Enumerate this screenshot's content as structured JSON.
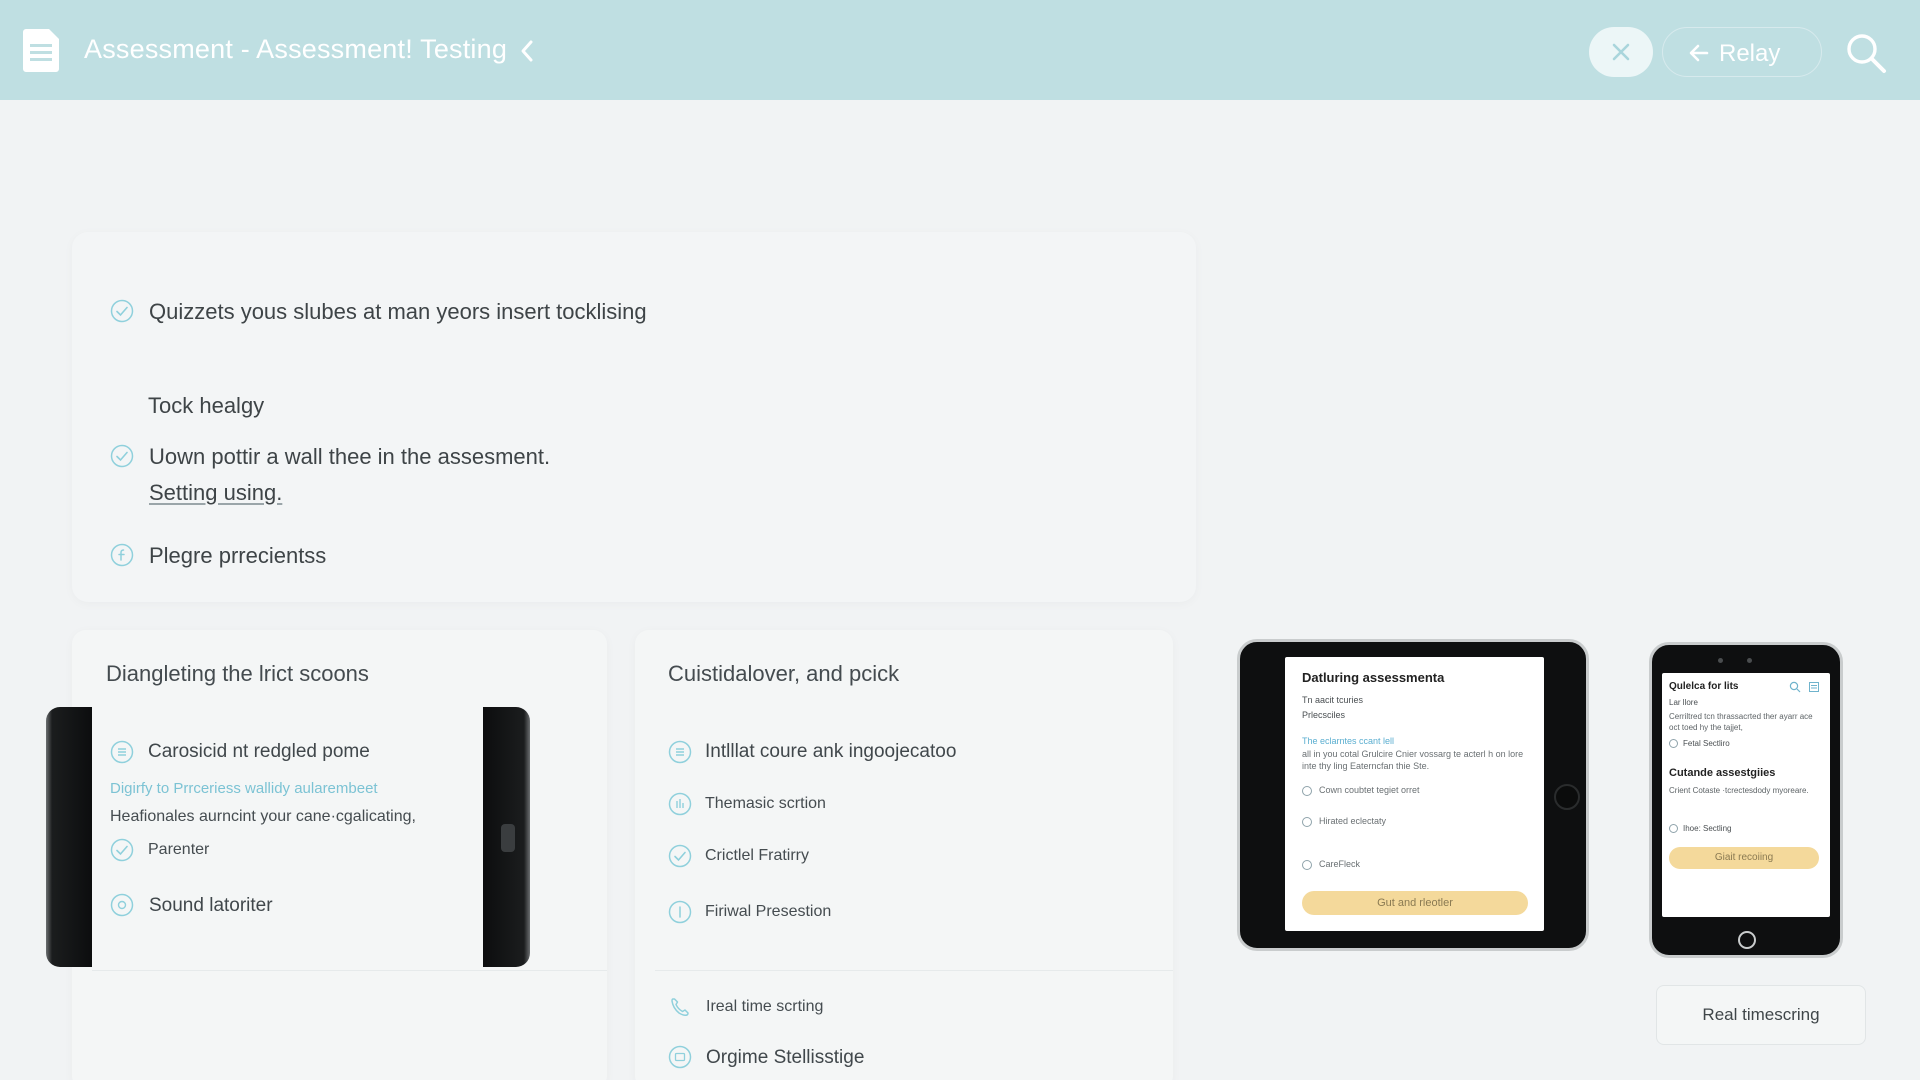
{
  "header": {
    "title": "Assessment - Assessment! Testing",
    "relay_label": "Relay"
  },
  "colors": {
    "header_bg": "#bfdfe2",
    "accent": "#7cc3d4",
    "primary_button": "#f4d99b"
  },
  "upper": {
    "items": [
      "Quizzets yous slubes at man yeors insert tocklising",
      "Tock healgy",
      "Uown pottir a wall thee in the assesment.",
      "Setting using.",
      "Plegre prrecientss"
    ]
  },
  "card_a": {
    "title": "Diangleting the lrict scoons",
    "row1": "Carosicid nt redgled pome",
    "link": "Digirfy to Prrceriess wallidy aularembeet",
    "note": "Heafionales aurncint your cane·cgalicating,",
    "row2": "Parenter",
    "row3": "Sound latoriter"
  },
  "card_b": {
    "title": "Cuistidalover, and pcick",
    "rows": [
      "Intlllat coure ank ingoojecatoo",
      "Themasic scrtion",
      "Crictlel Fratirry",
      "Firiwal Presestion",
      "Ireal time scrting",
      "Orgime Stellisstige"
    ]
  },
  "tablet": {
    "title": "Datluring assessmenta",
    "sub1": "Tn aacit tcuries",
    "sub2": "Prlecsciles",
    "body_link": "The eclarntes ccant lell",
    "body": "all in you cotal Grulcire Cnier vossarg te acterl h on lore inte thy ling Eaterncfan thie Ste.",
    "opt1": "Cown coubtet tegiet orret",
    "opt2": "Hirated eclectaty",
    "opt3": "CareFleck",
    "button": "Gut and rleotler"
  },
  "phone": {
    "title": "Qulelca for lits",
    "sub": "Lar llore",
    "body": "Cerriltred tcn thrassacrted ther ayarr ace oct toed hy the tajjet,",
    "opt1": "Fetal Sectliro",
    "heading": "Cutande assestgiies",
    "body2": "Crient Cotaste ·tcrectesdody myoreare.",
    "opt2": "Ihoe: Sectling",
    "button": "Giait recoiing"
  },
  "realtime_button": "Real timescring"
}
